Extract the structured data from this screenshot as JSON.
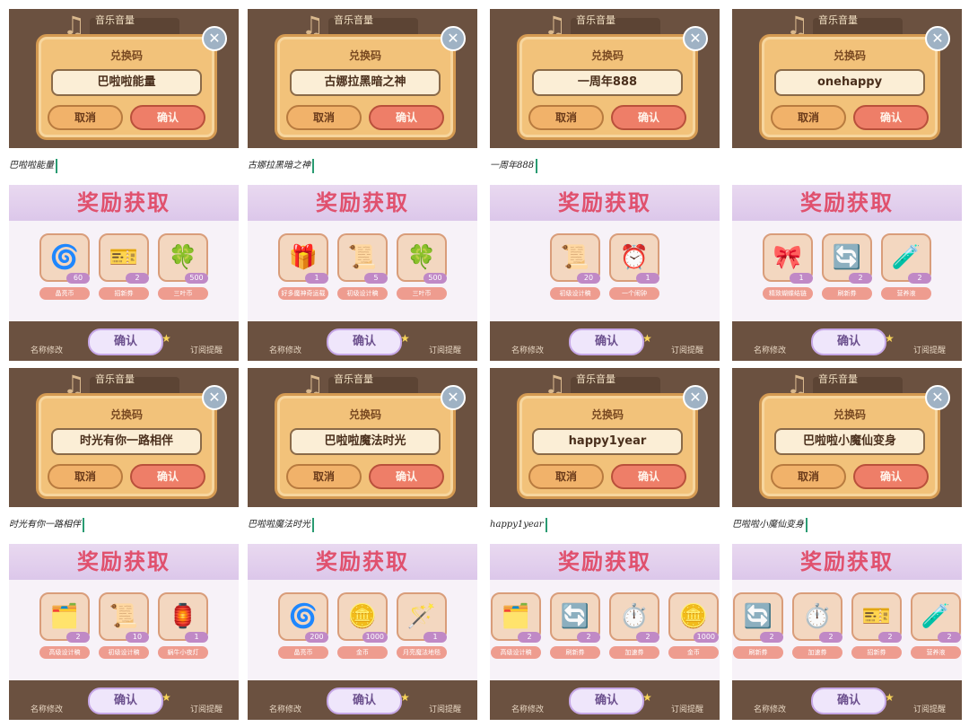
{
  "labels": {
    "music_volume": "音乐音量",
    "dialog_title": "兑换码",
    "cancel": "取消",
    "confirm": "确认",
    "reward_title": "奖励获取",
    "rename": "名称修改",
    "subscribe": "订阅提醒",
    "close_glyph": "✕"
  },
  "panels": [
    {
      "code": "巴啦啦能量",
      "typed": "巴啦啦能量",
      "items": [
        {
          "icon": "swirl-icon",
          "glyph": "🌀",
          "count": "60",
          "name": "晶亮币"
        },
        {
          "icon": "ticket-icon",
          "glyph": "🎫",
          "count": "2",
          "name": "招新券"
        },
        {
          "icon": "clover-icon",
          "glyph": "🍀",
          "count": "500",
          "name": "三叶币"
        }
      ]
    },
    {
      "code": "古娜拉黑暗之神",
      "typed": "古娜拉黑暗之神",
      "items": [
        {
          "icon": "item-pack-icon",
          "glyph": "🎁",
          "count": "1",
          "name": "好多魔神奇运载"
        },
        {
          "icon": "design-scroll-icon",
          "glyph": "📜",
          "count": "5",
          "name": "初级设计稿"
        },
        {
          "icon": "clover-icon",
          "glyph": "🍀",
          "count": "500",
          "name": "三叶币"
        }
      ]
    },
    {
      "code": "一周年888",
      "typed": "一周年888",
      "items": [
        {
          "icon": "design-scroll-icon",
          "glyph": "📜",
          "count": "20",
          "name": "初级设计稿"
        },
        {
          "icon": "alarm-clock-icon",
          "glyph": "⏰",
          "count": "1",
          "name": "一个闹钟"
        }
      ]
    },
    {
      "code": "onehappy",
      "typed": "",
      "items": [
        {
          "icon": "ribbon-icon",
          "glyph": "🎀",
          "count": "1",
          "name": "精致蝴蝶结链"
        },
        {
          "icon": "refresh-card-icon",
          "glyph": "🔄",
          "count": "2",
          "name": "刷新券"
        },
        {
          "icon": "potion-icon",
          "glyph": "🧪",
          "count": "2",
          "name": "营养液"
        }
      ]
    },
    {
      "code": "时光有你一路相伴",
      "typed": "时光有你一路相伴",
      "items": [
        {
          "icon": "design-pack-icon",
          "glyph": "🗂️",
          "count": "2",
          "name": "高级设计稿"
        },
        {
          "icon": "design-scroll-icon",
          "glyph": "📜",
          "count": "10",
          "name": "初级设计稿"
        },
        {
          "icon": "lamp-icon",
          "glyph": "🏮",
          "count": "1",
          "name": "蜗牛小夜灯"
        }
      ]
    },
    {
      "code": "巴啦啦魔法时光",
      "typed": "巴啦啦魔法时光",
      "items": [
        {
          "icon": "swirl-icon",
          "glyph": "🌀",
          "count": "200",
          "name": "晶亮币"
        },
        {
          "icon": "gold-coin-icon",
          "glyph": "🪙",
          "count": "1000",
          "name": "金币"
        },
        {
          "icon": "magic-stick-icon",
          "glyph": "🪄",
          "count": "1",
          "name": "月亮魔法地毯"
        }
      ]
    },
    {
      "code": "happy1year",
      "typed": "happy1year",
      "items": [
        {
          "icon": "design-pack-icon",
          "glyph": "🗂️",
          "count": "2",
          "name": "高级设计稿"
        },
        {
          "icon": "refresh-card-icon",
          "glyph": "🔄",
          "count": "2",
          "name": "刷新券"
        },
        {
          "icon": "speed-card-icon",
          "glyph": "⏱️",
          "count": "2",
          "name": "加速券"
        },
        {
          "icon": "gold-coin-icon",
          "glyph": "🪙",
          "count": "1000",
          "name": "金币"
        }
      ]
    },
    {
      "code": "巴啦啦小魔仙变身",
      "typed": "巴啦啦小魔仙变身",
      "items": [
        {
          "icon": "refresh-card-icon",
          "glyph": "🔄",
          "count": "2",
          "name": "刷新券"
        },
        {
          "icon": "speed-card-icon",
          "glyph": "⏱️",
          "count": "2",
          "name": "加速券"
        },
        {
          "icon": "ticket-icon",
          "glyph": "🎫",
          "count": "2",
          "name": "招新券"
        },
        {
          "icon": "potion-icon",
          "glyph": "🧪",
          "count": "2",
          "name": "营养液"
        }
      ]
    }
  ]
}
